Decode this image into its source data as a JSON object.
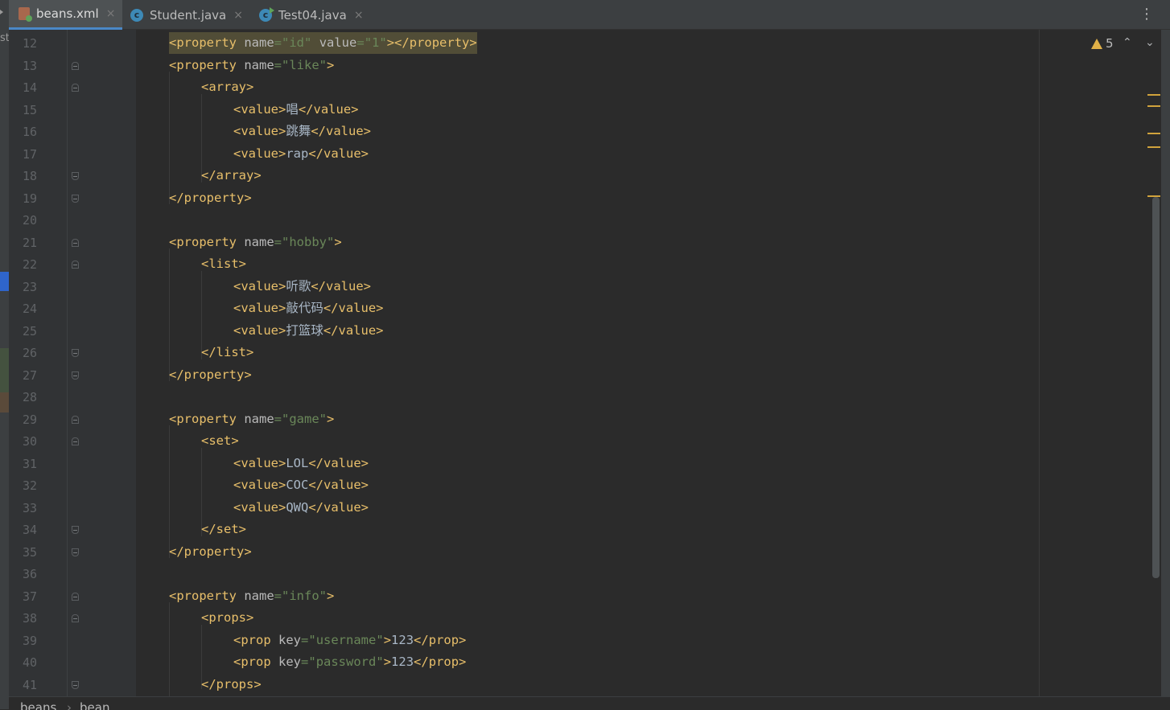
{
  "tabs": [
    {
      "label": "beans.xml",
      "icon": "xml-file-icon",
      "active": true,
      "close": "×"
    },
    {
      "label": "Student.java",
      "icon": "java-class-icon",
      "active": false,
      "close": "×"
    },
    {
      "label": "Test04.java",
      "icon": "java-runnable-class-icon",
      "active": false,
      "close": "×"
    }
  ],
  "more_menu": "⋮",
  "left_edge_text": "st",
  "editor": {
    "line_numbers": [
      "12",
      "13",
      "14",
      "15",
      "16",
      "17",
      "18",
      "19",
      "20",
      "21",
      "22",
      "23",
      "24",
      "25",
      "26",
      "27",
      "28",
      "29",
      "30",
      "31",
      "32",
      "33",
      "34",
      "35",
      "36",
      "37",
      "38",
      "39",
      "40",
      "41"
    ],
    "code": {
      "l12": {
        "open": "<property",
        "name_attr": "name",
        "eq1": "=",
        "name_val": "\"id\"",
        "value_attr": "value",
        "eq2": "=",
        "value_val": "\"1\"",
        "close": "></property>"
      },
      "l13": {
        "open": "<property",
        "attr": "name",
        "eq": "=",
        "val": "\"like\"",
        "close": ">"
      },
      "l14": "<array>",
      "l15": {
        "open": "<value>",
        "text": "唱",
        "close": "</value>"
      },
      "l16": {
        "open": "<value>",
        "text": "跳舞",
        "close": "</value>"
      },
      "l17": {
        "open": "<value>",
        "text": "rap",
        "close": "</value>"
      },
      "l18": "</array>",
      "l19": "</property>",
      "l21": {
        "open": "<property",
        "attr": "name",
        "eq": "=",
        "val": "\"hobby\"",
        "close": ">"
      },
      "l22": "<list>",
      "l23": {
        "open": "<value>",
        "text": "听歌",
        "close": "</value>"
      },
      "l24": {
        "open": "<value>",
        "text": "敲代码",
        "close": "</value>"
      },
      "l25": {
        "open": "<value>",
        "text": "打篮球",
        "close": "</value>"
      },
      "l26": "</list>",
      "l27": "</property>",
      "l29": {
        "open": "<property",
        "attr": "name",
        "eq": "=",
        "val": "\"game\"",
        "close": ">"
      },
      "l30": "<set>",
      "l31": {
        "open": "<value>",
        "text": "LOL",
        "close": "</value>"
      },
      "l32": {
        "open": "<value>",
        "text": "COC",
        "close": "</value>"
      },
      "l33": {
        "open": "<value>",
        "text": "QWQ",
        "close": "</value>"
      },
      "l34": "</set>",
      "l35": "</property>",
      "l37": {
        "open": "<property",
        "attr": "name",
        "eq": "=",
        "val": "\"info\"",
        "close": ">"
      },
      "l38": "<props>",
      "l39": {
        "open": "<prop",
        "attr": "key",
        "eq": "=",
        "val": "\"username\"",
        "gt": ">",
        "text": "123",
        "close": "</prop>"
      },
      "l40": {
        "open": "<prop",
        "attr": "key",
        "eq": "=",
        "val": "\"password\"",
        "gt": ">",
        "text": "123",
        "close": "</prop>"
      },
      "l41": "</props>"
    }
  },
  "inspections": {
    "warning_count": "5",
    "prev": "⌃",
    "next": "⌄"
  },
  "breadcrumb": {
    "items": [
      "beans",
      "bean"
    ],
    "separator": "›"
  },
  "colors": {
    "tag": "#e8bf6a",
    "attr_value": "#6a8759",
    "attr_name": "#bababa",
    "text": "#a9b7c6",
    "background": "#2b2b2b",
    "active_tab_underline": "#4a88c7",
    "warning": "#e0b047"
  }
}
